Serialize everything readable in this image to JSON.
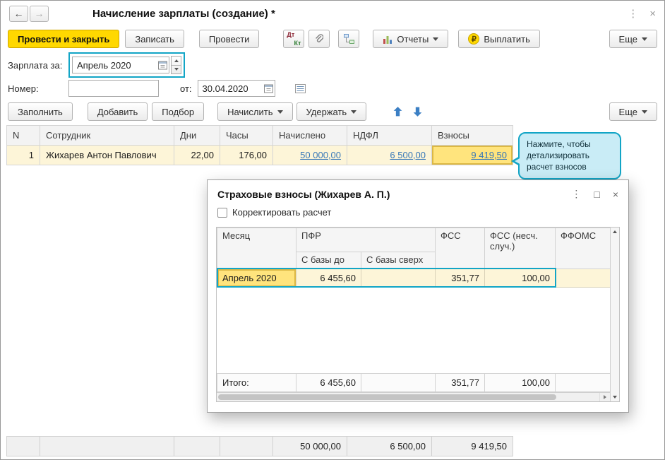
{
  "icons": {
    "back": "←",
    "forward": "→",
    "menu": "⋮",
    "close": "×",
    "maximize": "□",
    "ruble": "₽"
  },
  "titlebar": {
    "title": "Начисление зарплаты (создание) *"
  },
  "toolbar": {
    "post_and_close": "Провести и закрыть",
    "save": "Записать",
    "post": "Провести",
    "dt": "Дт",
    "kt": "Кт",
    "reports": "Отчеты",
    "pay": "Выплатить",
    "more": "Еще"
  },
  "form": {
    "salary_for_label": "Зарплата за:",
    "salary_for_value": "Апрель 2020",
    "number_label": "Номер:",
    "number_value": "",
    "from_label": "от:",
    "date_value": "30.04.2020"
  },
  "table_toolbar": {
    "fill": "Заполнить",
    "add": "Добавить",
    "pick": "Подбор",
    "accrue": "Начислить",
    "withhold": "Удержать",
    "more": "Еще"
  },
  "grid": {
    "columns": [
      "N",
      "Сотрудник",
      "Дни",
      "Часы",
      "Начислено",
      "НДФЛ",
      "Взносы"
    ],
    "rows": [
      {
        "n": "1",
        "employee": "Жихарев Антон Павлович",
        "days": "22,00",
        "hours": "176,00",
        "accrued": "50 000,00",
        "ndfl": "6 500,00",
        "contributions": "9 419,50"
      }
    ]
  },
  "callout": {
    "text": "Нажмите, чтобы детализировать расчет взносов"
  },
  "modal": {
    "title": "Страховые взносы (Жихарев А. П.)",
    "checkbox_label": "Корректировать расчет",
    "columns": {
      "month": "Месяц",
      "pfr": "ПФР",
      "base_under": "С базы до",
      "base_over": "С базы сверх",
      "fss": "ФСС",
      "fss_acc": "ФСС (несч. случ.)",
      "ffoms": "ФФОМС"
    },
    "row": {
      "month": "Апрель 2020",
      "base_under": "6 455,60",
      "base_over": "",
      "fss": "351,77",
      "fss_acc": "100,00",
      "ffoms": ""
    },
    "totals_label": "Итого:",
    "totals": {
      "base_under": "6 455,60",
      "base_over": "",
      "fss": "351,77",
      "fss_acc": "100,00",
      "ffoms": ""
    }
  },
  "footer": {
    "accrued": "50 000,00",
    "ndfl": "6 500,00",
    "contributions": "9 419,50"
  }
}
